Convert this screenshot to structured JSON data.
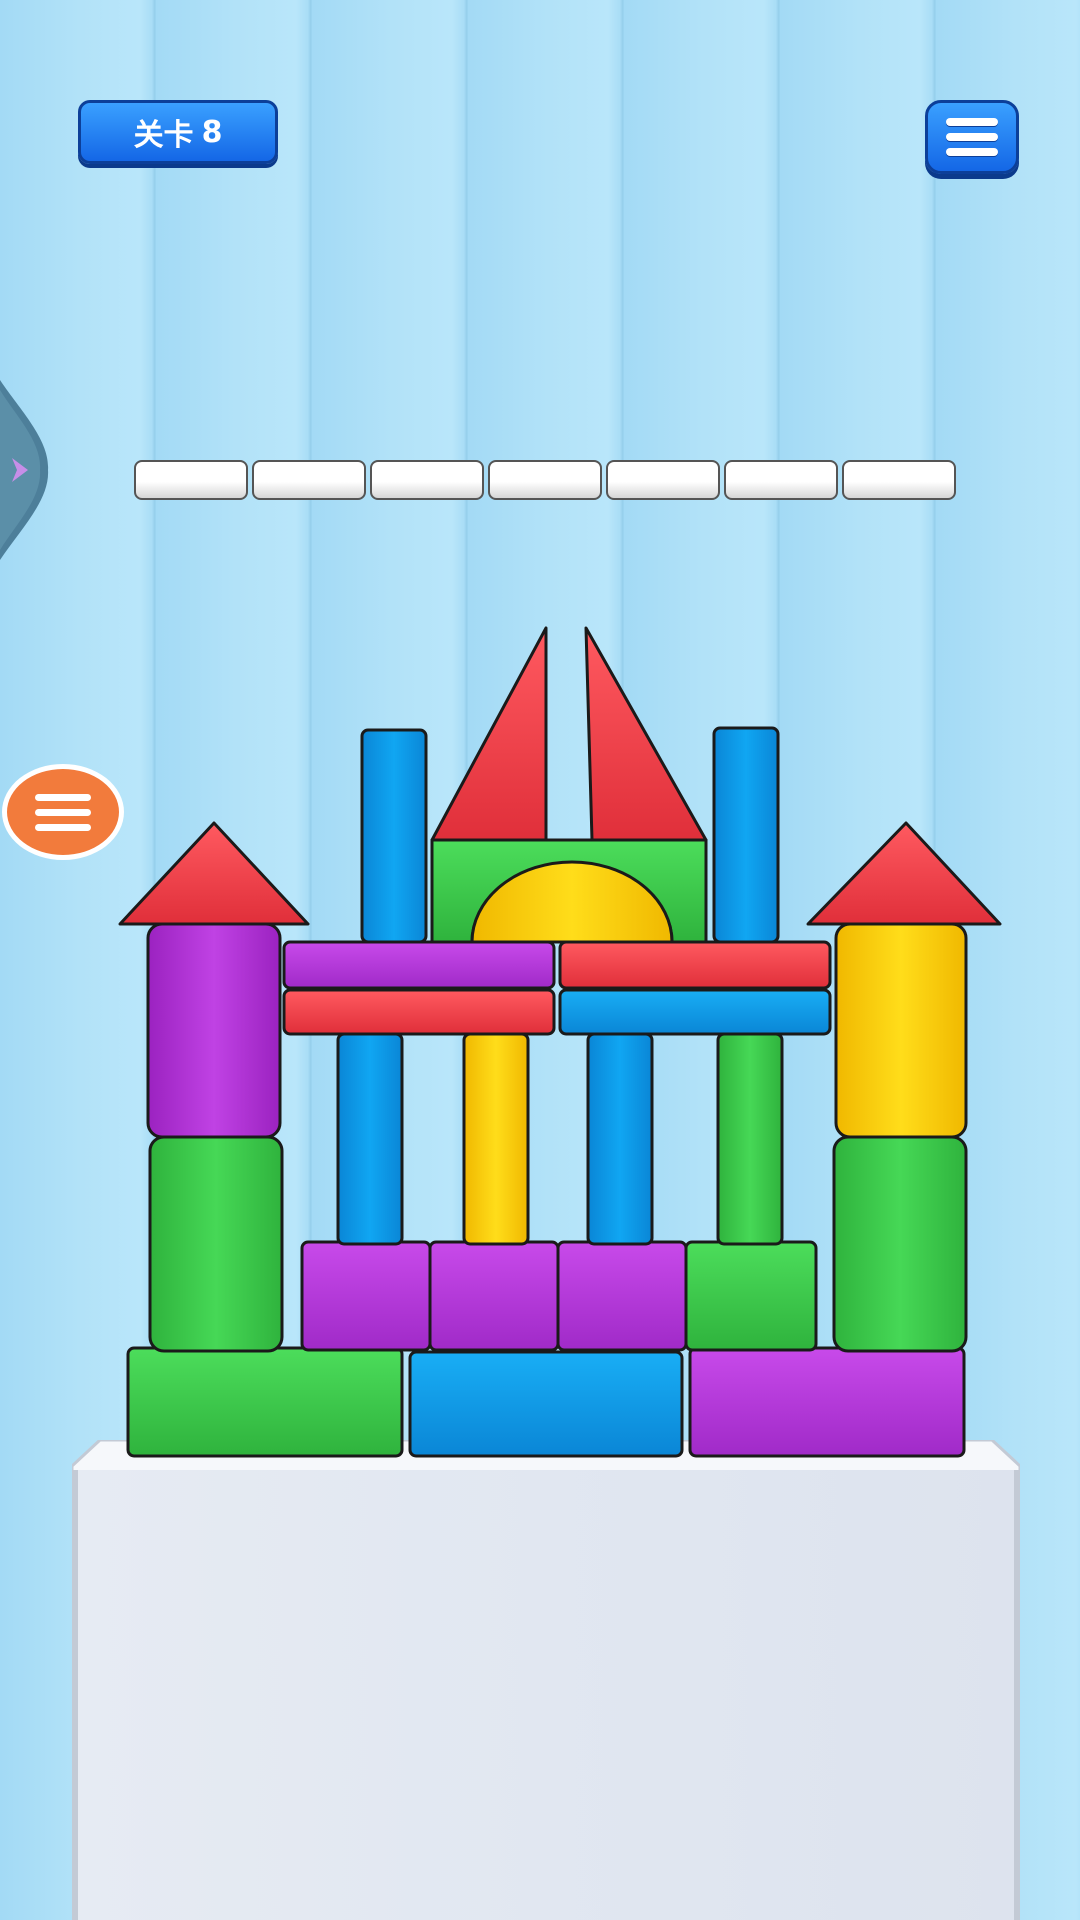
{
  "hud": {
    "level_label": "关卡",
    "level_number": "8",
    "menu_button": "hamburger-menu-icon",
    "side_menu_button": "hamburger-menu-icon",
    "side_tab": "chevron-right-icon"
  },
  "progress": {
    "total_segments": 7,
    "filled_segments": 0
  },
  "colors": {
    "red": "#f23d46",
    "blue": "#0b9bea",
    "green": "#3ccd4b",
    "purple": "#b535d8",
    "yellow": "#ffd40a",
    "sky": "#a6dcf6",
    "badge_blue": "#1f7ff0",
    "side_orange": "#f27b3c"
  }
}
